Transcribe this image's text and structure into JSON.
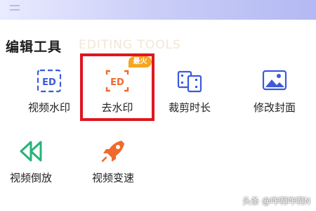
{
  "section": {
    "title": "编辑工具",
    "watermark_text": "EDITING TOOLS"
  },
  "tools": [
    {
      "label": "视频水印",
      "icon": "video-watermark-icon"
    },
    {
      "label": "去水印",
      "icon": "remove-watermark-icon",
      "badge": "最火"
    },
    {
      "label": "裁剪时长",
      "icon": "trim-duration-icon"
    },
    {
      "label": "修改封面",
      "icon": "change-cover-icon"
    },
    {
      "label": "视频倒放",
      "icon": "reverse-play-icon"
    },
    {
      "label": "视频变速",
      "icon": "speed-change-icon"
    }
  ],
  "credit": "头条 @咋啊咋啊N",
  "colors": {
    "accent_blue": "#3b5bdb",
    "accent_orange": "#f06a2b",
    "accent_green": "#25b37a",
    "highlight_red": "#e0161f",
    "badge_orange": "#f5a623"
  }
}
